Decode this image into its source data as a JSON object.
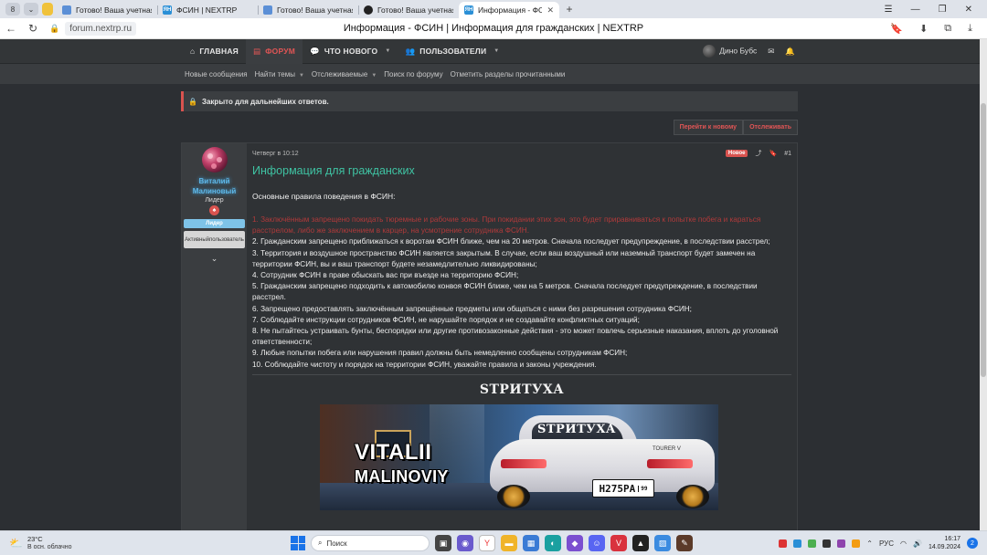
{
  "browser": {
    "left_chips": [
      "8",
      "⌄"
    ],
    "tabs": [
      {
        "title": "Готово! Ваша учетная зап",
        "favicon": "doc-icon",
        "favicon_color": "#5b8fd6",
        "favicon_text": "",
        "active": false
      },
      {
        "title": "ФСИН | NEXTRP",
        "favicon": "nextrp-icon",
        "favicon_color": "#2a8fd6",
        "favicon_text": "ЯН",
        "active": false
      },
      {
        "title": "Готово! Ваша учетная зап",
        "favicon": "doc-icon",
        "favicon_color": "#5b8fd6",
        "favicon_text": "",
        "active": false
      },
      {
        "title": "Готово! Ваша учетная зап",
        "favicon": "circle-icon",
        "favicon_color": "#222222",
        "favicon_text": "",
        "active": false
      },
      {
        "title": "Информация - ФСИН | N",
        "favicon": "nextrp-icon",
        "favicon_color": "#2a8fd6",
        "favicon_text": "ЯН",
        "active": true
      }
    ],
    "url": "forum.nextrp.ru",
    "page_title": "Информация - ФСИН | Информация для гражданских | NEXTRP"
  },
  "site": {
    "nav": [
      {
        "label": "ГЛАВНАЯ",
        "icon": "home-icon",
        "active": false
      },
      {
        "label": "ФОРУМ",
        "icon": "forum-icon",
        "active": true
      },
      {
        "label": "ЧТО НОВОГО",
        "icon": "whatsnew-icon",
        "active": false,
        "dropdown": true
      },
      {
        "label": "ПОЛЬЗОВАТЕЛИ",
        "icon": "users-icon",
        "active": false,
        "dropdown": true
      }
    ],
    "account_name": "Дино Бубс",
    "subnav": [
      {
        "label": "Новые сообщения",
        "dropdown": false
      },
      {
        "label": "Найти темы",
        "dropdown": true
      },
      {
        "label": "Отслеживаемые",
        "dropdown": true
      },
      {
        "label": "Поиск по форуму",
        "dropdown": false
      },
      {
        "label": "Отметить разделы прочитанными",
        "dropdown": false
      }
    ],
    "notice": "Закрыто для дальнейших ответов.",
    "actions": [
      "Перейти к новому",
      "Отслеживать"
    ]
  },
  "post": {
    "author": {
      "name_line1": "Виталий",
      "name_line2": "Малиновый",
      "title": "Лидер",
      "role_badge": "Лидер",
      "status_badge_line1": "Активный",
      "status_badge_line2": "пользователь"
    },
    "date": "Четверг в 10:12",
    "new_label": "Новое",
    "post_number": "#1",
    "title": "Информация для гражданских",
    "intro": "Основные правила поведения в ФСИН:",
    "rules": [
      {
        "text": "1. Заключённым запрещено покидать тюремные и рабочие зоны. При покидании этих зон, это будет приравниваться к попытке побега и караться расстрелом, либо же заключением в карцер, на усмотрение сотрудника ФСИН.",
        "red": true
      },
      {
        "text": "2. Гражданским запрещено приближаться к воротам ФСИН ближе, чем на 20 метров. Сначала последует предупреждение, в последствии расстрел;",
        "red": false
      },
      {
        "text": "3. Территория и воздушное пространство ФСИН является закрытым. В случае, если ваш воздушный или наземный транспорт будет замечен на территории ФСИН, вы и ваш транспорт будете незамедлительно ликвидированы;",
        "red": false
      },
      {
        "text": "4. Сотрудник ФСИН в праве обыскать вас при въезде на территорию ФСИН;",
        "red": false
      },
      {
        "text": "5. Гражданским запрещено подходить к автомобилю конвоя ФСИН ближе, чем на 5 метров. Сначала последует предупреждение, в последствии расстрел.",
        "red": false
      },
      {
        "text": "6. Запрещено предоставлять заключённым запрещённые предметы или общаться с ними без разрешения сотрудника ФСИН;",
        "red": false
      },
      {
        "text": "7. Соблюдайте инструкции сотрудников ФСИН, не нарушайте порядок и не создавайте конфликтных ситуаций;",
        "red": false
      },
      {
        "text": "8. Не пытайтесь устраивать бунты, беспорядки или другие противозаконные действия - это может повлечь серьезные наказания, вплоть до уголовной ответственности;",
        "red": false
      },
      {
        "text": "9. Любые попытки побега или нарушения правил должны быть немедленно сообщены сотрудникам ФСИН;",
        "red": false
      },
      {
        "text": "10. Соблюдайте чистоту и порядок на территории ФСИН, уважайте правила и законы учреждения.",
        "red": false
      }
    ],
    "signature": {
      "title": "STРИТУХА",
      "banner_line1": "VITALII",
      "banner_line2": "MALINOVIY",
      "car_sticker": "STРИТУХА",
      "plate": "H275PA",
      "plate_region": "99",
      "car_badge": "TOURER V"
    }
  },
  "taskbar": {
    "temp": "23°C",
    "weather": "В осн. облачно",
    "search_label": "Поиск",
    "lang": "РУС",
    "time": "16:17",
    "date": "14.09.2024",
    "notifications": "2"
  },
  "colors": {
    "accent": "#e05555",
    "title_green": "#3fc3a3",
    "username_blue": "#5fb6e6",
    "rule_red": "#b03a3a"
  }
}
